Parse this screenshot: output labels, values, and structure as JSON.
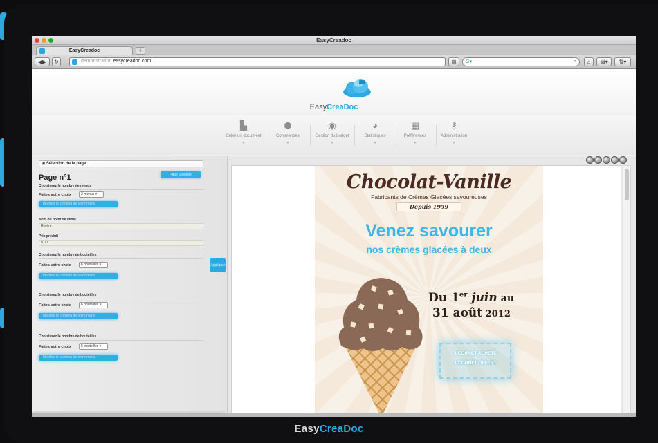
{
  "app": {
    "window_title": "EasyCreadoc",
    "tab_label": "EasyCreadoc",
    "url_prefix": "demonstration.",
    "url_domain": "easycreadoc.com",
    "search_value": "",
    "bezel_brand_part1": "Easy",
    "bezel_brand_part2": "CreaDoc"
  },
  "site": {
    "logo_part1": "Easy",
    "logo_part2": "CreaDoc",
    "menu": [
      {
        "label": "Créer un document",
        "icon": "document-icon"
      },
      {
        "label": "Commandes",
        "icon": "box-icon"
      },
      {
        "label": "Gestion du budget",
        "icon": "coin-icon"
      },
      {
        "label": "Statistiques",
        "icon": "pie-chart-icon"
      },
      {
        "label": "Préférences",
        "icon": "list-icon"
      },
      {
        "label": "Administration",
        "icon": "key-icon"
      }
    ]
  },
  "panel": {
    "selection_label": "Sélection de la page",
    "page_title": "Page n°1",
    "page_button": "Page suivante",
    "menus_group_label": "Choisissez le nombre de menus",
    "menus_choice_label": "Faites votre choix",
    "menus_choice_value": "3 menus",
    "modify_button": "Modifier le contenu de votre menu",
    "point_label": "Nom du point de vente",
    "point_value": "Rivière",
    "price_label": "Prix produit",
    "price_value": "0,00",
    "bottles_group_label": "Choisissez le nombre de bouteilles",
    "bottles_choice_label": "Faites votre choix",
    "bottles_choice_value": "6 bouteilles",
    "apply_tab": "Appliquer"
  },
  "flyer": {
    "brand": "Chocolat-Vanille",
    "subtitle": "Fabricants de Crèmes Glacées savoureuses",
    "since": "Depuis 1959",
    "headline1": "Venez savourer",
    "headline2": "nos crèmes glacées à deux",
    "date_prefix": "Du 1",
    "date_sup": "er",
    "date_month": " juin",
    "date_au": " au",
    "date_line2": "31 août",
    "date_year": " 2012",
    "offer_line1": "1 CORNET ACHETÉ",
    "offer_plus": "+",
    "offer_line2": "1 CORNET OFFERT"
  },
  "colors": {
    "accent": "#2ea8e0",
    "flyer_brown": "#4a2a22",
    "flyer_blue": "#3fb6e4"
  }
}
